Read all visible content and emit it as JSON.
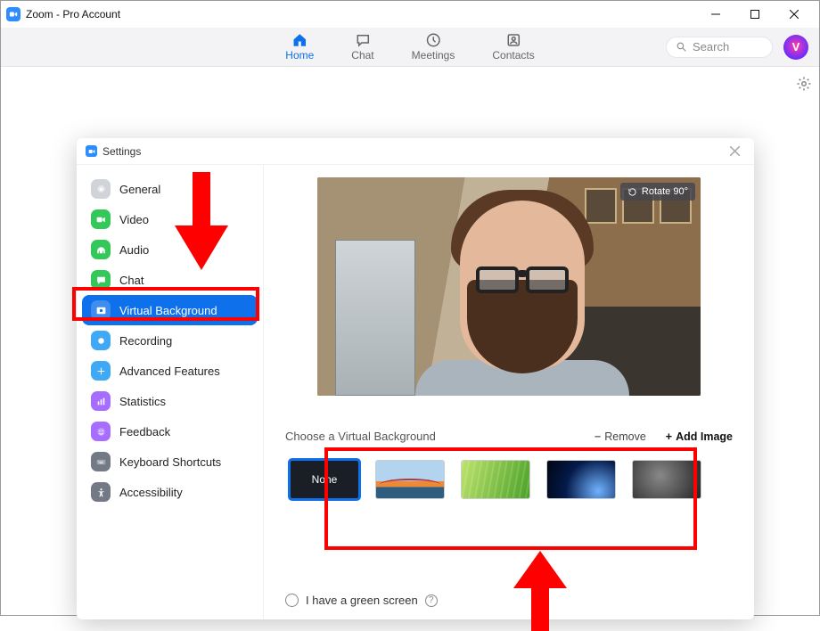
{
  "window": {
    "title": "Zoom - Pro Account"
  },
  "topnav": {
    "items": [
      {
        "label": "Home",
        "active": true
      },
      {
        "label": "Chat"
      },
      {
        "label": "Meetings"
      },
      {
        "label": "Contacts"
      }
    ],
    "search_placeholder": "Search"
  },
  "settings": {
    "title": "Settings",
    "sidebar": [
      {
        "label": "General"
      },
      {
        "label": "Video"
      },
      {
        "label": "Audio"
      },
      {
        "label": "Chat"
      },
      {
        "label": "Virtual Background",
        "active": true
      },
      {
        "label": "Recording"
      },
      {
        "label": "Advanced Features"
      },
      {
        "label": "Statistics"
      },
      {
        "label": "Feedback"
      },
      {
        "label": "Keyboard Shortcuts"
      },
      {
        "label": "Accessibility"
      }
    ],
    "preview": {
      "rotate_label": "Rotate 90°"
    },
    "choose_label": "Choose a Virtual Background",
    "remove_label": "Remove",
    "add_label": "Add Image",
    "thumbs": {
      "none_label": "None"
    },
    "green_screen_label": "I have a green screen"
  }
}
